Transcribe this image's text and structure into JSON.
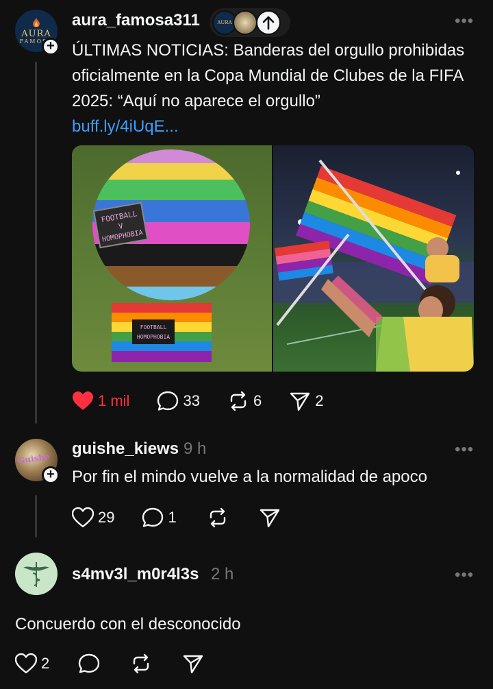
{
  "colors": {
    "background": "#101010",
    "text": "#f3f5f7",
    "muted": "#777777",
    "link": "#3d9eff",
    "like_red": "#ff3040"
  },
  "post": {
    "avatar_text_1": "AURA",
    "avatar_text_2": "FAMOSA",
    "username": "aura_famosa311",
    "text": "ÚLTIMAS NOTICIAS: Banderas del orgullo prohibidas oficialmente en la Copa Mundial de Clubes de la FIFA 2025: “Aquí no aparece el orgullo”",
    "link": "buff.ly/4iUqE...",
    "media": {
      "left_sign_text_1": "FOOTBALL",
      "left_sign_text_2": "V",
      "left_sign_text_3": "HOMOPHOBIA"
    },
    "likes": "1 mil",
    "replies": "33",
    "reposts": "6",
    "shares": "2"
  },
  "reply1": {
    "username": "guishe_kiews",
    "time": "9 h",
    "text": "Por fin el mindo vuelve a la normalidad de apoco",
    "likes": "29",
    "replies": "1"
  },
  "reply2": {
    "username": "s4mv3l_m0r4l3s",
    "time": "2 h",
    "text": "Concuerdo con el desconocido",
    "likes": "2"
  },
  "icons": [
    "heart-icon",
    "comment-icon",
    "repost-icon",
    "send-icon",
    "more-icon",
    "arrow-up-icon",
    "plus-icon"
  ]
}
